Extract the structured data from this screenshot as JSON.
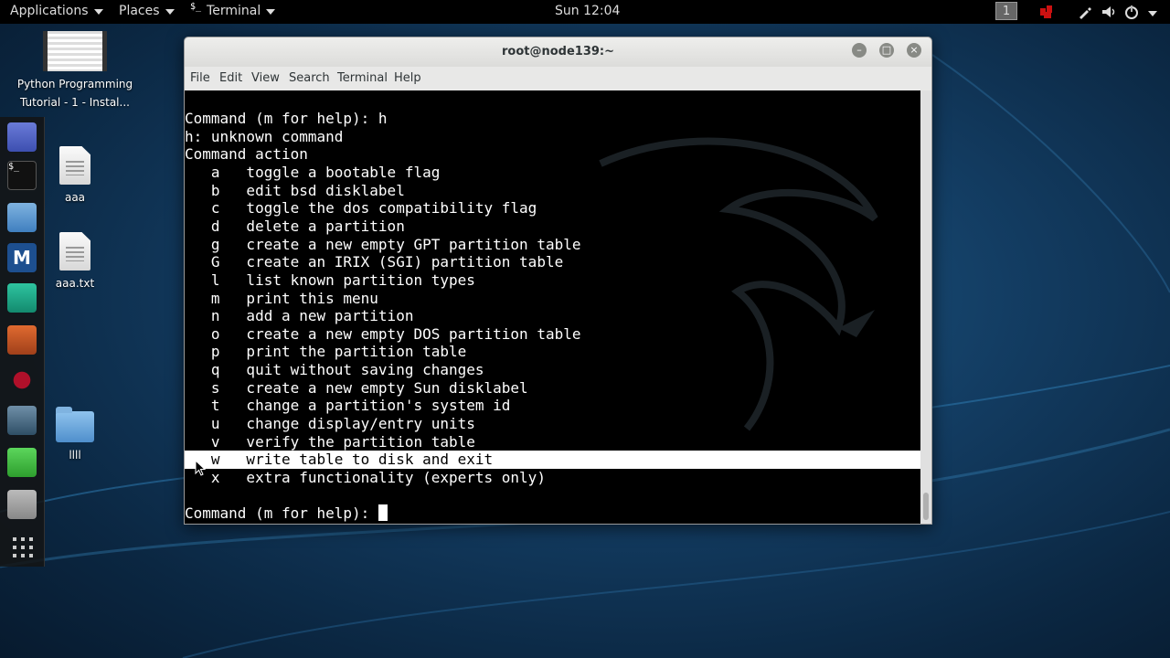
{
  "topbar": {
    "applications": "Applications",
    "places": "Places",
    "terminal_menu": "Terminal",
    "clock": "Sun 12:04",
    "workspace": "1"
  },
  "desktop": {
    "video_label": "Python Programming Tutorial - 1 - Instal...",
    "file1_label": "aaa",
    "file2_label": "aaa.txt",
    "folder_label": "llll"
  },
  "window": {
    "title": "root@node139:~",
    "menu": [
      "File",
      "Edit",
      "View",
      "Search",
      "Terminal",
      "Help"
    ]
  },
  "terminal": {
    "lines": [
      "Command (m for help): h",
      "h: unknown command",
      "Command action",
      "   a   toggle a bootable flag",
      "   b   edit bsd disklabel",
      "   c   toggle the dos compatibility flag",
      "   d   delete a partition",
      "   g   create a new empty GPT partition table",
      "   G   create an IRIX (SGI) partition table",
      "   l   list known partition types",
      "   m   print this menu",
      "   n   add a new partition",
      "   o   create a new empty DOS partition table",
      "   p   print the partition table",
      "   q   quit without saving changes",
      "   s   create a new empty Sun disklabel",
      "   t   change a partition's system id",
      "   u   change display/entry units",
      "   v   verify the partition table",
      "   w   write table to disk and exit",
      "   x   extra functionality (experts only)",
      "",
      "Command (m for help): "
    ]
  },
  "colors": {
    "accent_red": "#cc1111",
    "terminal_bg": "#000000",
    "terminal_fg": "#ffffff"
  }
}
